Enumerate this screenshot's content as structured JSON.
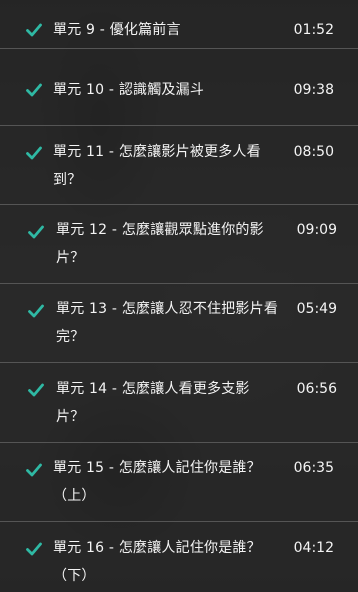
{
  "lessons": [
    {
      "title": "單元 9 - 優化篇前言",
      "duration": "01:52",
      "completed": true
    },
    {
      "title": "單元 10 - 認識觸及漏斗",
      "duration": "09:38",
      "completed": true
    },
    {
      "title": "單元 11 - 怎麼讓影片被更多人看到？",
      "duration": "08:50",
      "completed": true
    },
    {
      "title": "單元 12 - 怎麼讓觀眾點進你的影片？",
      "duration": "09:09",
      "completed": true
    },
    {
      "title": "單元 13 - 怎麼讓人忍不住把影片看完？",
      "duration": "05:49",
      "completed": true
    },
    {
      "title": "單元 14 - 怎麼讓人看更多支影片？",
      "duration": "06:56",
      "completed": true
    },
    {
      "title": "單元 15 - 怎麼讓人記住你是誰？（上）",
      "duration": "06:35",
      "completed": true
    },
    {
      "title": "單元 16 - 怎麼讓人記住你是誰？（下）",
      "duration": "04:12",
      "completed": true
    }
  ],
  "colors": {
    "check": "#2fb9a4",
    "text": "#f4f4f4",
    "divider": "#555555"
  },
  "icons": {
    "completed": "checkmark-icon"
  }
}
